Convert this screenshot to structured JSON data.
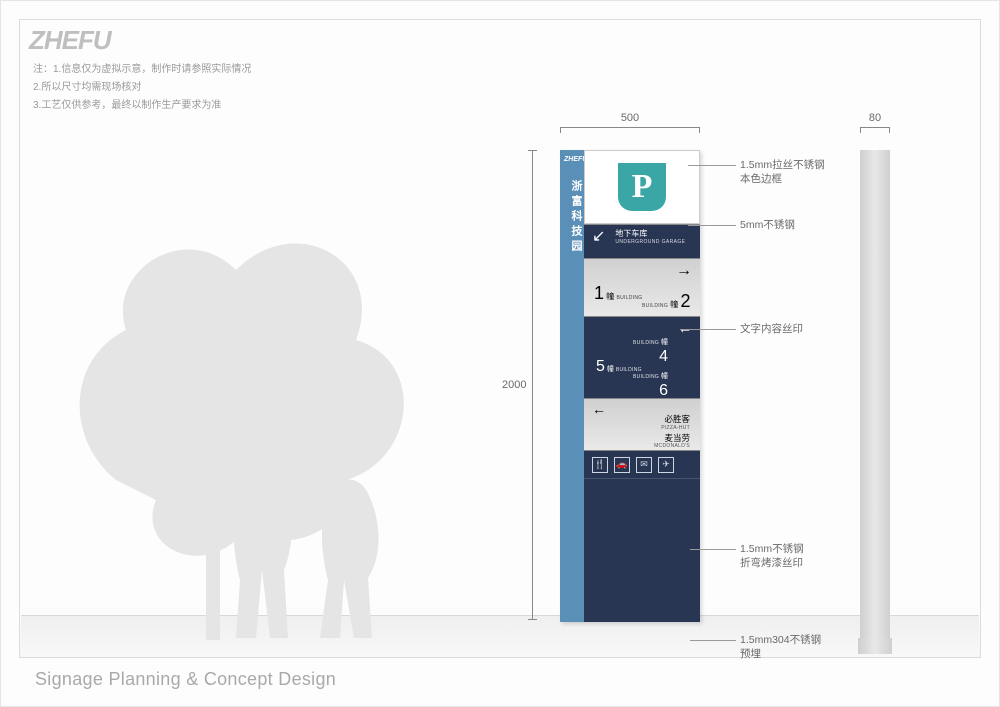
{
  "logo_text": "ZHEFU",
  "notes": "注：1.信息仅为虚拟示意，制作时请参照实际情况\n2.所以尺寸均需现场核对\n3.工艺仅供参考，最终以制作生产要求为准",
  "footer": "Signage Planning & Concept Design",
  "dimensions": {
    "width_mm": "500",
    "height_mm": "2000",
    "depth_mm": "80"
  },
  "callouts": {
    "c1": "1.5mm拉丝不锈钢\n本色边框",
    "c2": "5mm不锈钢",
    "c3": "文字内容丝印",
    "c4": "1.5mm不锈钢\n折弯烤漆丝印",
    "c5": "1.5mm304不锈钢\n预埋"
  },
  "sign": {
    "spine_brand": "ZHEFU",
    "spine_title": "浙富科技园",
    "parking_letter": "P",
    "panel_a": {
      "cn": "地下车库",
      "en": "UNDERGROUND GARAGE"
    },
    "panel_b": {
      "b1_num": "1",
      "b1_unit": "幢",
      "b1_en": "BUILDING",
      "b2_en": "BUILDING",
      "b2_unit": "幢",
      "b2_num": "2"
    },
    "panel_c": {
      "r1_en": "BUILDING",
      "r1_unit": "幢",
      "r1_num": "4",
      "r2_num": "5",
      "r2_unit": "幢",
      "r2_en": "BUILDING",
      "r3_en": "BUILDING",
      "r3_unit": "幢",
      "r3_num": "6"
    },
    "panel_d": {
      "l1_cn": "必胜客",
      "l1_en": "PIZZA-HUT",
      "l2_cn": "麦当劳",
      "l2_en": "MCDONALD'S"
    },
    "icons": [
      "🍴",
      "🚗",
      "✉",
      "✈"
    ]
  }
}
